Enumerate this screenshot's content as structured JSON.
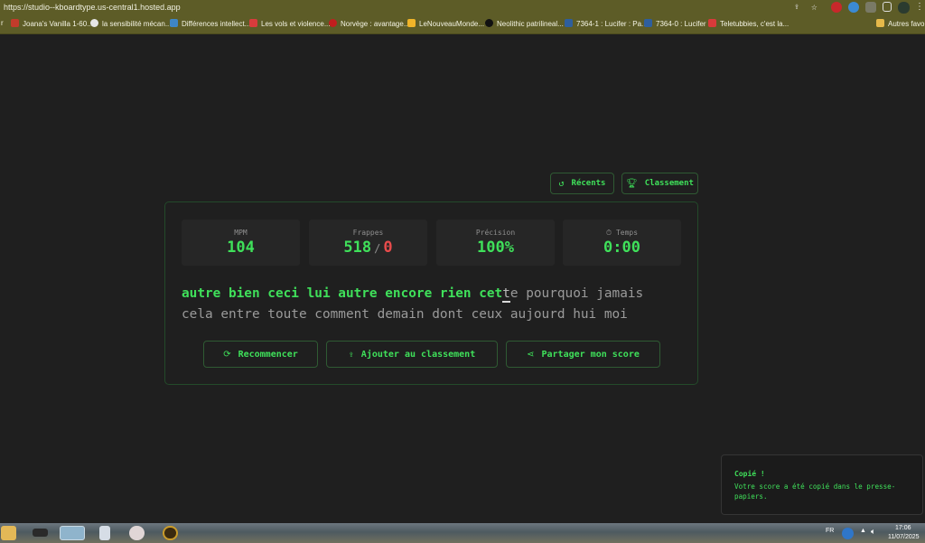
{
  "browser": {
    "url": "https://studio--kboardtype.us-central1.hosted.app",
    "bookmarks": [
      {
        "label": "r",
        "color": "#5d5c27"
      },
      {
        "label": "Joana's Vanilla 1-60...",
        "color": "#c23b2b"
      },
      {
        "label": "la sensibilité mécan...",
        "color": "#e6e6e6"
      },
      {
        "label": "Différences intellect...",
        "color": "#3e86c7"
      },
      {
        "label": "Les vols et violence...",
        "color": "#d83c3c"
      },
      {
        "label": "Norvège : avantage...",
        "color": "#c21e1e"
      },
      {
        "label": "LeNouveauMonde...",
        "color": "#f0b429"
      },
      {
        "label": "Neolithic patrilineal...",
        "color": "#111111"
      },
      {
        "label": "7364-1 : Lucifer : Pa...",
        "color": "#2e5f9e"
      },
      {
        "label": "7364-0 : Lucifer",
        "color": "#2e5f9e"
      },
      {
        "label": "Teletubbies, c'est la...",
        "color": "#d93a3a"
      },
      {
        "label": "Autres favoris",
        "color": "#e6b94a"
      }
    ]
  },
  "top_buttons": {
    "recent": "Récents",
    "leaderboard": "Classement"
  },
  "stats": {
    "wpm": {
      "label": "MPM",
      "value": "104"
    },
    "keystrokes": {
      "label": "Frappes",
      "correct": "518",
      "separator": "/",
      "errors": "0"
    },
    "accuracy": {
      "label": "Précision",
      "value": "100%"
    },
    "time": {
      "label": "Temps",
      "value": "0:00"
    }
  },
  "typing": {
    "line1_typed": "autre bien ceci lui autre encore rien cet",
    "line1_cursor": "t",
    "line1_rest": "e pourquoi jamais",
    "line2": "cela entre toute comment demain dont ceux aujourd hui moi"
  },
  "actions": {
    "restart": "Recommencer",
    "add": "Ajouter au classement",
    "share": "Partager mon score"
  },
  "toast": {
    "title": "Copié !",
    "body": "Votre score a été copié dans le presse-papiers."
  },
  "taskbar": {
    "lang": "FR",
    "time": "17:06",
    "date": "11/07/2025"
  },
  "colors": {
    "accent": "#3fe05a",
    "error": "#e84b4b",
    "background": "#1f1f1f",
    "chrome": "#5d5c27"
  }
}
